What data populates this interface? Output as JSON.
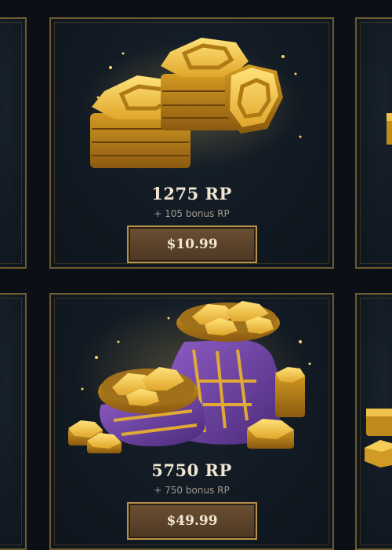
{
  "store": {
    "packs": [
      {
        "amount": "1275 RP",
        "bonus": "+ 105 bonus RP",
        "price": "$10.99",
        "icon": "rp-coin-stack-icon"
      },
      {
        "amount": "5750 RP",
        "bonus": "+ 750 bonus RP",
        "price": "$49.99",
        "icon": "rp-coin-bag-icon"
      }
    ]
  },
  "colors": {
    "background": "#0a1016",
    "card_border": "#6e5a2e",
    "gold": "#e8b53a",
    "button": "#5a412a",
    "text_primary": "#f0e6d2",
    "text_secondary": "#a09b8c"
  }
}
